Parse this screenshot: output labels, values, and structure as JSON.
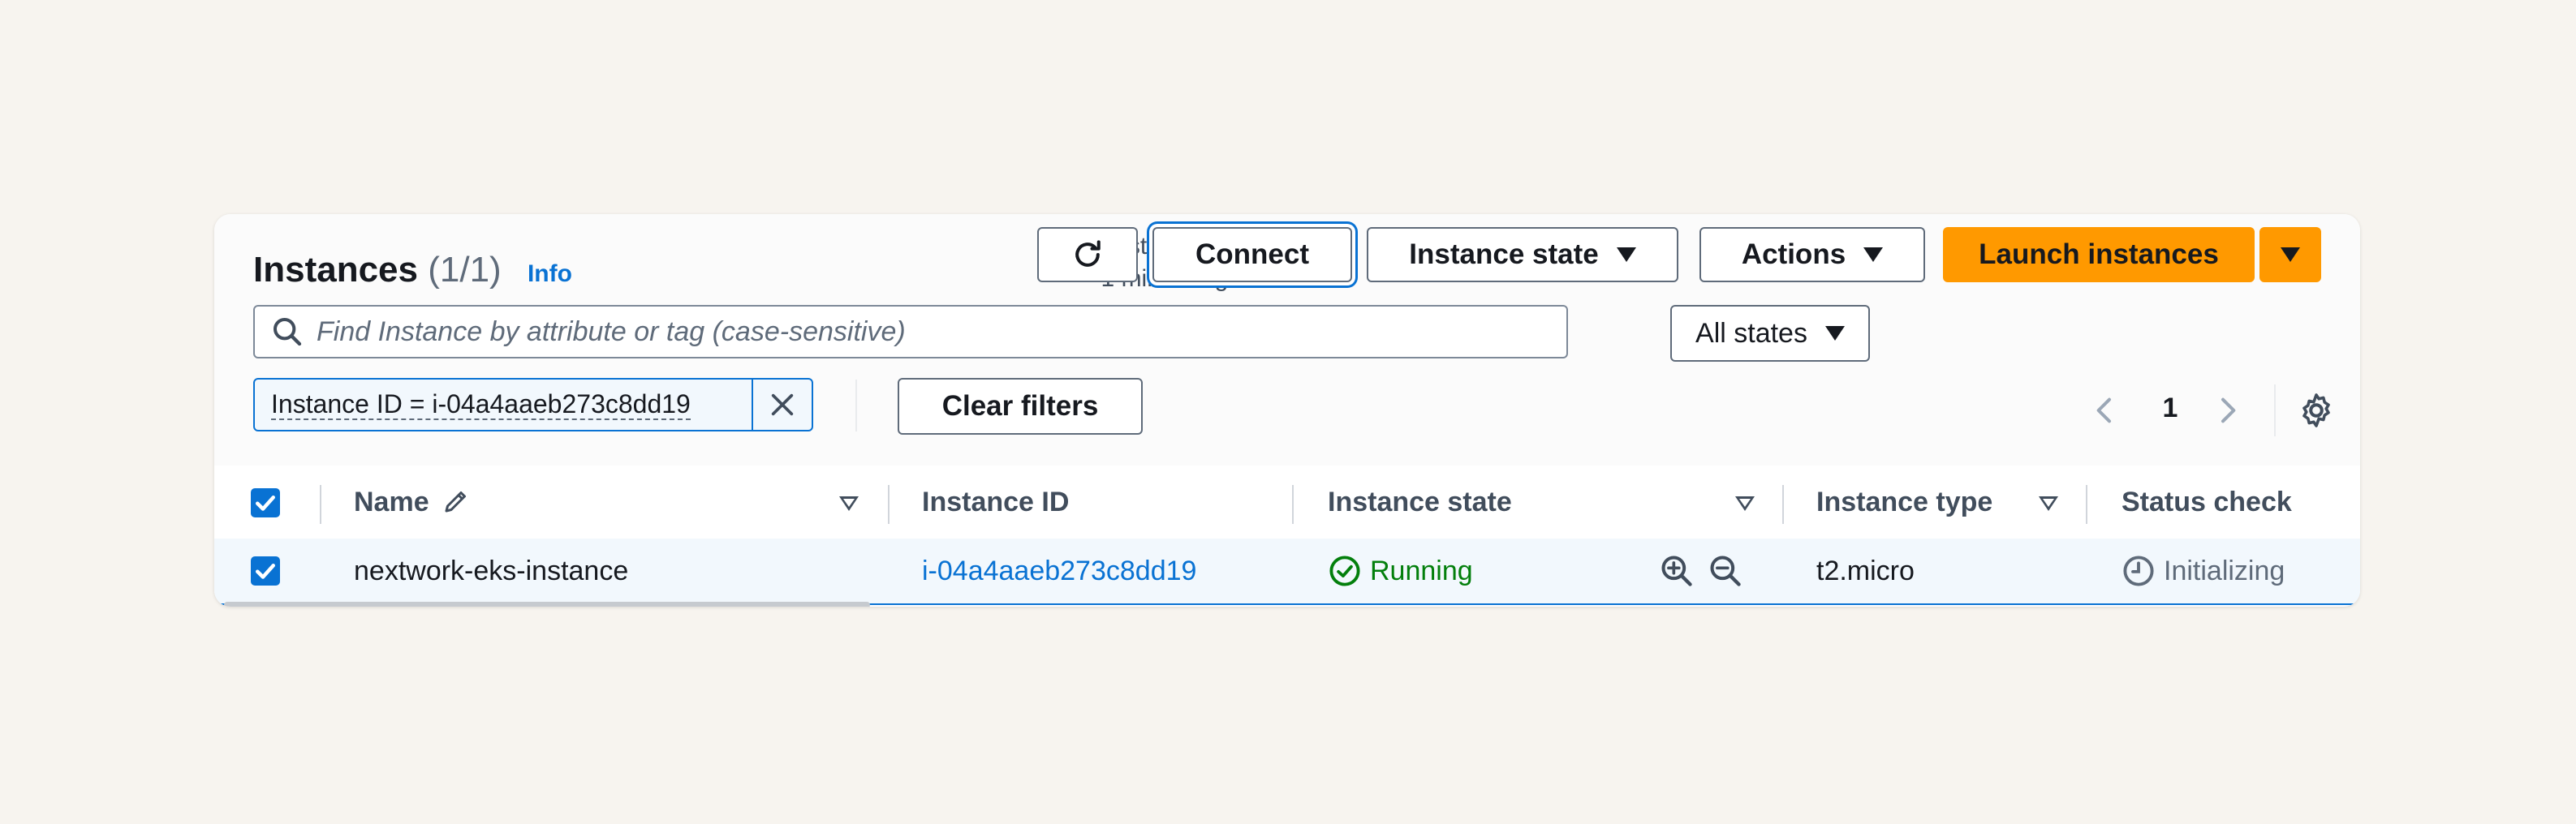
{
  "header": {
    "title": "Instances",
    "count": "(1/1)",
    "info_link": "Info",
    "last_updated_line1": "Last updated",
    "last_updated_line2": "1 minute ago"
  },
  "toolbar": {
    "connect_label": "Connect",
    "instance_state_label": "Instance state",
    "actions_label": "Actions",
    "launch_label": "Launch instances"
  },
  "search": {
    "placeholder": "Find Instance by attribute or tag (case-sensitive)",
    "value": ""
  },
  "state_filter": {
    "selected": "All states"
  },
  "filters": {
    "token": "Instance ID = i-04a4aaeb273c8dd19",
    "clear_label": "Clear filters"
  },
  "pagination": {
    "current_page": "1"
  },
  "table": {
    "columns": {
      "name": "Name",
      "instance_id": "Instance ID",
      "instance_state": "Instance state",
      "instance_type": "Instance type",
      "status_check": "Status check"
    },
    "rows": [
      {
        "name": "nextwork-eks-instance",
        "instance_id": "i-04a4aaeb273c8dd19",
        "instance_state": "Running",
        "instance_type": "t2.micro",
        "status_check": "Initializing",
        "selected": true
      }
    ]
  },
  "colors": {
    "primary": "#0972d3",
    "launch": "#ff9900",
    "running": "#037f0c",
    "muted": "#5f6b7a"
  },
  "icons": [
    "refresh-icon",
    "caret-down-icon",
    "search-icon",
    "close-icon",
    "chevron-left-icon",
    "chevron-right-icon",
    "gear-icon",
    "edit-icon",
    "checkbox-icon",
    "check-circle-icon",
    "zoom-in-icon",
    "zoom-out-icon",
    "clock-icon"
  ]
}
